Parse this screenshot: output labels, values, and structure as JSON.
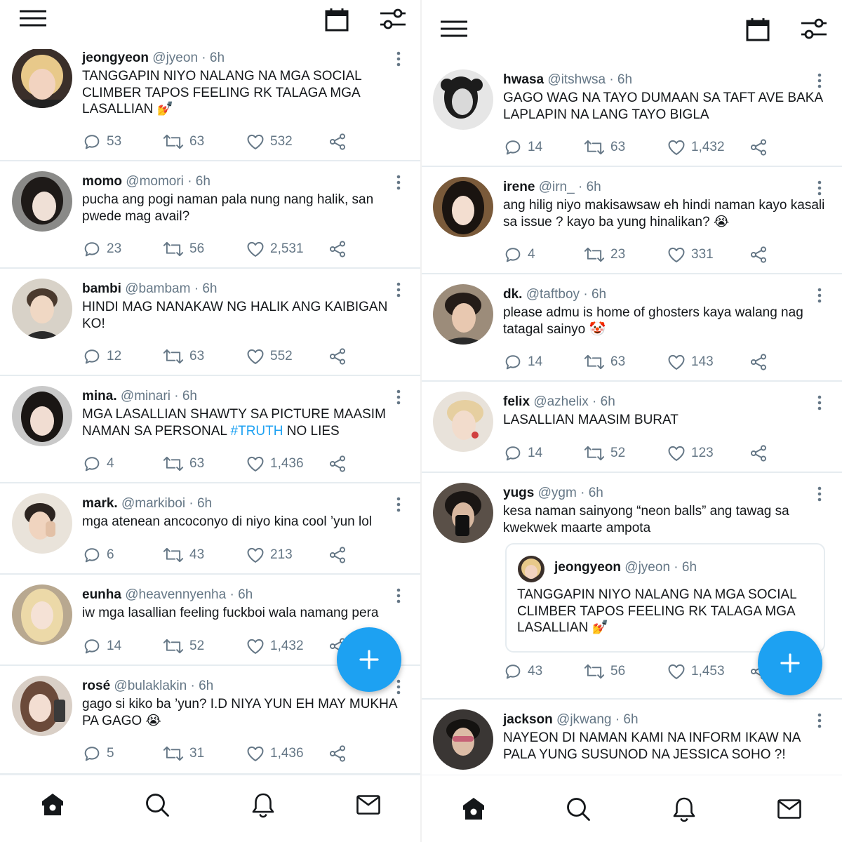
{
  "app": {
    "accent_color": "#1da1f2",
    "text_color": "#14171a",
    "muted_color": "#657786",
    "icons": {
      "top_left": "hamburger-menu-icon",
      "top_right": [
        "calendar-icon",
        "settings-sliders-icon"
      ],
      "actions": [
        "reply-icon",
        "retweet-icon",
        "like-icon",
        "share-icon"
      ],
      "bottom_nav": [
        "home-icon",
        "search-icon",
        "notifications-icon",
        "messages-icon"
      ],
      "fab": "compose-plus-icon"
    }
  },
  "left_feed": {
    "tweets": [
      {
        "name": "jeongyeon",
        "handle": "@jyeon",
        "dot": "·",
        "time": "6h",
        "text": "TANGGAPIN NIYO NALANG NA MGA SOCIAL CLIMBER TAPOS FEELING RK TALAGA MGA LASALLIAN 💅",
        "replies": "53",
        "retweets": "63",
        "likes": "532"
      },
      {
        "name": "momo",
        "handle": "@momori",
        "dot": "·",
        "time": "6h",
        "text": "pucha ang pogi naman pala nung nang halik, san pwede mag avail?",
        "replies": "23",
        "retweets": "56",
        "likes": "2,531"
      },
      {
        "name": "bambi",
        "handle": "@bambam",
        "dot": "·",
        "time": "6h",
        "text": "HINDI MAG NANAKAW NG HALIK ANG KAIBIGAN KO!",
        "replies": "12",
        "retweets": "63",
        "likes": "552"
      },
      {
        "name": "mina.",
        "handle": "@minari",
        "dot": "·",
        "time": "6h",
        "text_before": "MGA LASALLIAN SHAWTY SA PICTURE MAASIM NAMAN SA PERSONAL ",
        "hashtag": "#TRUTH",
        "text_after": " NO LIES",
        "replies": "4",
        "retweets": "63",
        "likes": "1,436"
      },
      {
        "name": "mark.",
        "handle": "@markiboi",
        "dot": "·",
        "time": "6h",
        "text": "mga atenean ancoconyo di niyo kina cool ’yun lol",
        "replies": "6",
        "retweets": "43",
        "likes": "213"
      },
      {
        "name": "eunha",
        "handle": "@heavennyenha",
        "dot": "·",
        "time": "6h",
        "text": "iw mga lasallian feeling fuckboi wala namang pera",
        "replies": "14",
        "retweets": "52",
        "likes": "1,432"
      },
      {
        "name": "rosé",
        "handle": "@bulaklakin",
        "dot": "·",
        "time": "6h",
        "text": "gago si kiko ba ’yun? I.D NIYA YUN EH MAY MUKHA PA GAGO 😭",
        "replies": "5",
        "retweets": "31",
        "likes": "1,436"
      }
    ]
  },
  "right_feed": {
    "tweets": [
      {
        "name": "hwasa",
        "handle": "@itshwsa",
        "dot": "·",
        "time": "6h",
        "text": "GAGO WAG NA TAYO DUMAAN SA TAFT AVE BAKA LAPLAPIN NA LANG TAYO BIGLA",
        "replies": "14",
        "retweets": "63",
        "likes": "1,432"
      },
      {
        "name": "irene",
        "handle": "@irn_",
        "dot": "·",
        "time": "6h",
        "text": "ang hilig niyo makisawsaw eh hindi naman kayo kasali sa issue ? kayo ba yung hinalikan? 😭",
        "replies": "4",
        "retweets": "23",
        "likes": "331"
      },
      {
        "name": "dk.",
        "handle": "@taftboy",
        "dot": "·",
        "time": "6h",
        "text": "please admu is home of ghosters kaya walang nag tatagal sainyo 🤡",
        "replies": "14",
        "retweets": "63",
        "likes": "143"
      },
      {
        "name": "felix",
        "handle": "@azhelix",
        "dot": "·",
        "time": "6h",
        "text": "LASALLIAN MAASIM BURAT",
        "replies": "14",
        "retweets": "52",
        "likes": "123"
      },
      {
        "name": "yugs",
        "handle": "@ygm",
        "dot": "·",
        "time": "6h",
        "text": "kesa naman sainyong “neon balls” ang tawag sa kwekwek maarte ampota",
        "quote": {
          "name": "jeongyeon",
          "handle": "@jyeon",
          "dot": "·",
          "time": "6h",
          "text": "TANGGAPIN NIYO NALANG NA MGA SOCIAL CLIMBER TAPOS FEELING RK TALAGA MGA LASALLIAN 💅"
        },
        "replies": "43",
        "retweets": "56",
        "likes": "1,453"
      },
      {
        "name": "jackson",
        "handle": "@jkwang",
        "dot": "·",
        "time": "6h",
        "text": "NAYEON DI NAMAN KAMI NA INFORM IKAW NA PALA YUNG SUSUNOD NA JESSICA SOHO ?!"
      }
    ]
  }
}
